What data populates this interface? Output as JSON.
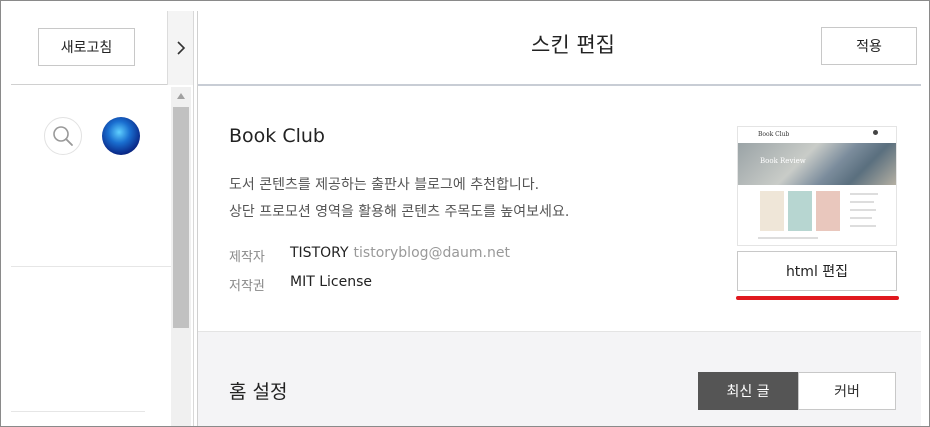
{
  "left": {
    "refresh_label": "새로고침",
    "search_icon": "search-icon",
    "avatar_icon": "avatar"
  },
  "toggle_icon": "chevron-right-icon",
  "header": {
    "title": "스킨 편집",
    "apply_label": "적용"
  },
  "skin": {
    "name": "Book Club",
    "description_line1": "도서 콘텐츠를 제공하는 출판사 블로그에 추천합니다.",
    "description_line2": "상단 프로모션 영역을 활용해 콘텐츠 주목도를 높여보세요.",
    "author_label": "제작자",
    "author_name": "TISTORY",
    "author_email": "tistoryblog@daum.net",
    "license_label": "저작권",
    "license_value": "MIT License",
    "thumbnail": {
      "site_title": "Book Club",
      "hero_text": "Book Review"
    },
    "html_edit_label": "html 편집"
  },
  "home_settings": {
    "title": "홈 설정",
    "options": [
      "최신 글",
      "커버"
    ],
    "selected": "최신 글"
  },
  "colors": {
    "accent_underline": "#e0181e",
    "segment_active_bg": "#555555"
  }
}
